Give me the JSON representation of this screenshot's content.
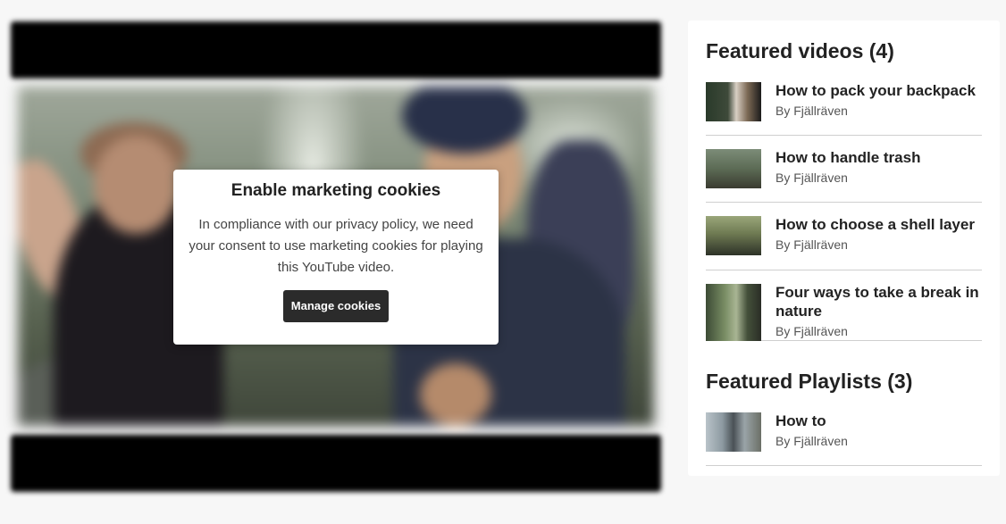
{
  "cookie_modal": {
    "title": "Enable marketing cookies",
    "text": "In compliance with our privacy policy, we need your consent to use marketing cookies for playing this YouTube video.",
    "button_label": "Manage cookies"
  },
  "sidebar": {
    "videos_title": "Featured videos (4)",
    "videos": [
      {
        "title": "How to pack your backpack",
        "author": "By Fjällräven"
      },
      {
        "title": "How to handle trash",
        "author": "By Fjällräven"
      },
      {
        "title": "How to choose a shell layer",
        "author": "By Fjällräven"
      },
      {
        "title": "Four ways to take a break in nature",
        "author": "By Fjällräven"
      }
    ],
    "playlists_title": "Featured Playlists (3)",
    "playlists": [
      {
        "title": "How to",
        "author": "By Fjällräven"
      }
    ]
  }
}
